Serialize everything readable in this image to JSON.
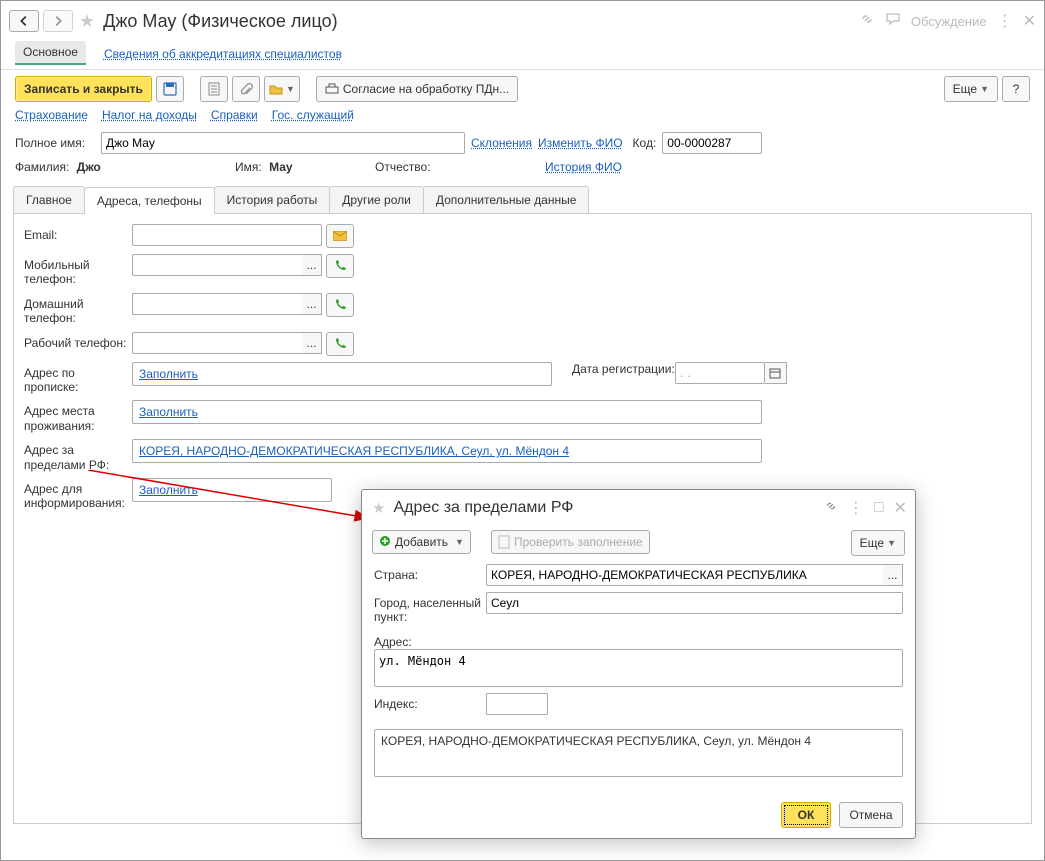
{
  "header": {
    "title": "Джо Мау (Физическое лицо)",
    "discuss": "Обсуждение"
  },
  "nav_tabs": {
    "main": "Основное",
    "accred": "Сведения об аккредитациях специалистов"
  },
  "toolbar": {
    "save_close": "Записать и закрыть",
    "consent": "Согласие на обработку ПДн...",
    "more": "Еще",
    "help": "?"
  },
  "sublinks": {
    "insurance": "Страхование",
    "tax": "Налог на доходы",
    "refs": "Справки",
    "gov": "Гос. служащий"
  },
  "name_row": {
    "label": "Полное имя:",
    "value": "Джо Мау",
    "decl": "Склонения",
    "change": "Изменить ФИО",
    "code_label": "Код:",
    "code": "00-0000287"
  },
  "fio": {
    "surname_label": "Фамилия:",
    "surname": "Джо",
    "name_label": "Имя:",
    "name": "Мау",
    "patr_label": "Отчество:",
    "history": "История ФИО"
  },
  "tabs": {
    "main": "Главное",
    "addr": "Адреса, телефоны",
    "work": "История работы",
    "roles": "Другие роли",
    "extra": "Дополнительные данные"
  },
  "fields": {
    "email": "Email:",
    "mobile": "Мобильный телефон:",
    "home": "Домашний телефон:",
    "work_phone": "Рабочий телефон:",
    "reg_addr": "Адрес по прописке:",
    "reg_date": "Дата регистрации:",
    "reg_date_val": ". .",
    "live_addr": "Адрес места проживания:",
    "foreign_addr": "Адрес за пределами РФ:",
    "foreign_value": "КОРЕЯ, НАРОДНО-ДЕМОКРАТИЧЕСКАЯ РЕСПУБЛИКА, Сеул, ул. Мёндон 4",
    "info_addr": "Адрес для информирования:",
    "fill": "Заполнить"
  },
  "dialog": {
    "title": "Адрес за пределами РФ",
    "add": "Добавить",
    "check": "Проверить заполнение",
    "more": "Еще",
    "country_label": "Страна:",
    "country": "КОРЕЯ, НАРОДНО-ДЕМОКРАТИЧЕСКАЯ РЕСПУБЛИКА",
    "city_label": "Город, населенный пункт:",
    "city": "Сеул",
    "addr_label": "Адрес:",
    "addr": "ул. Мёндон 4",
    "index_label": "Индекс:",
    "summary": "КОРЕЯ, НАРОДНО-ДЕМОКРАТИЧЕСКАЯ РЕСПУБЛИКА, Сеул, ул. Мёндон 4",
    "ok": "ОК",
    "cancel": "Отмена"
  }
}
